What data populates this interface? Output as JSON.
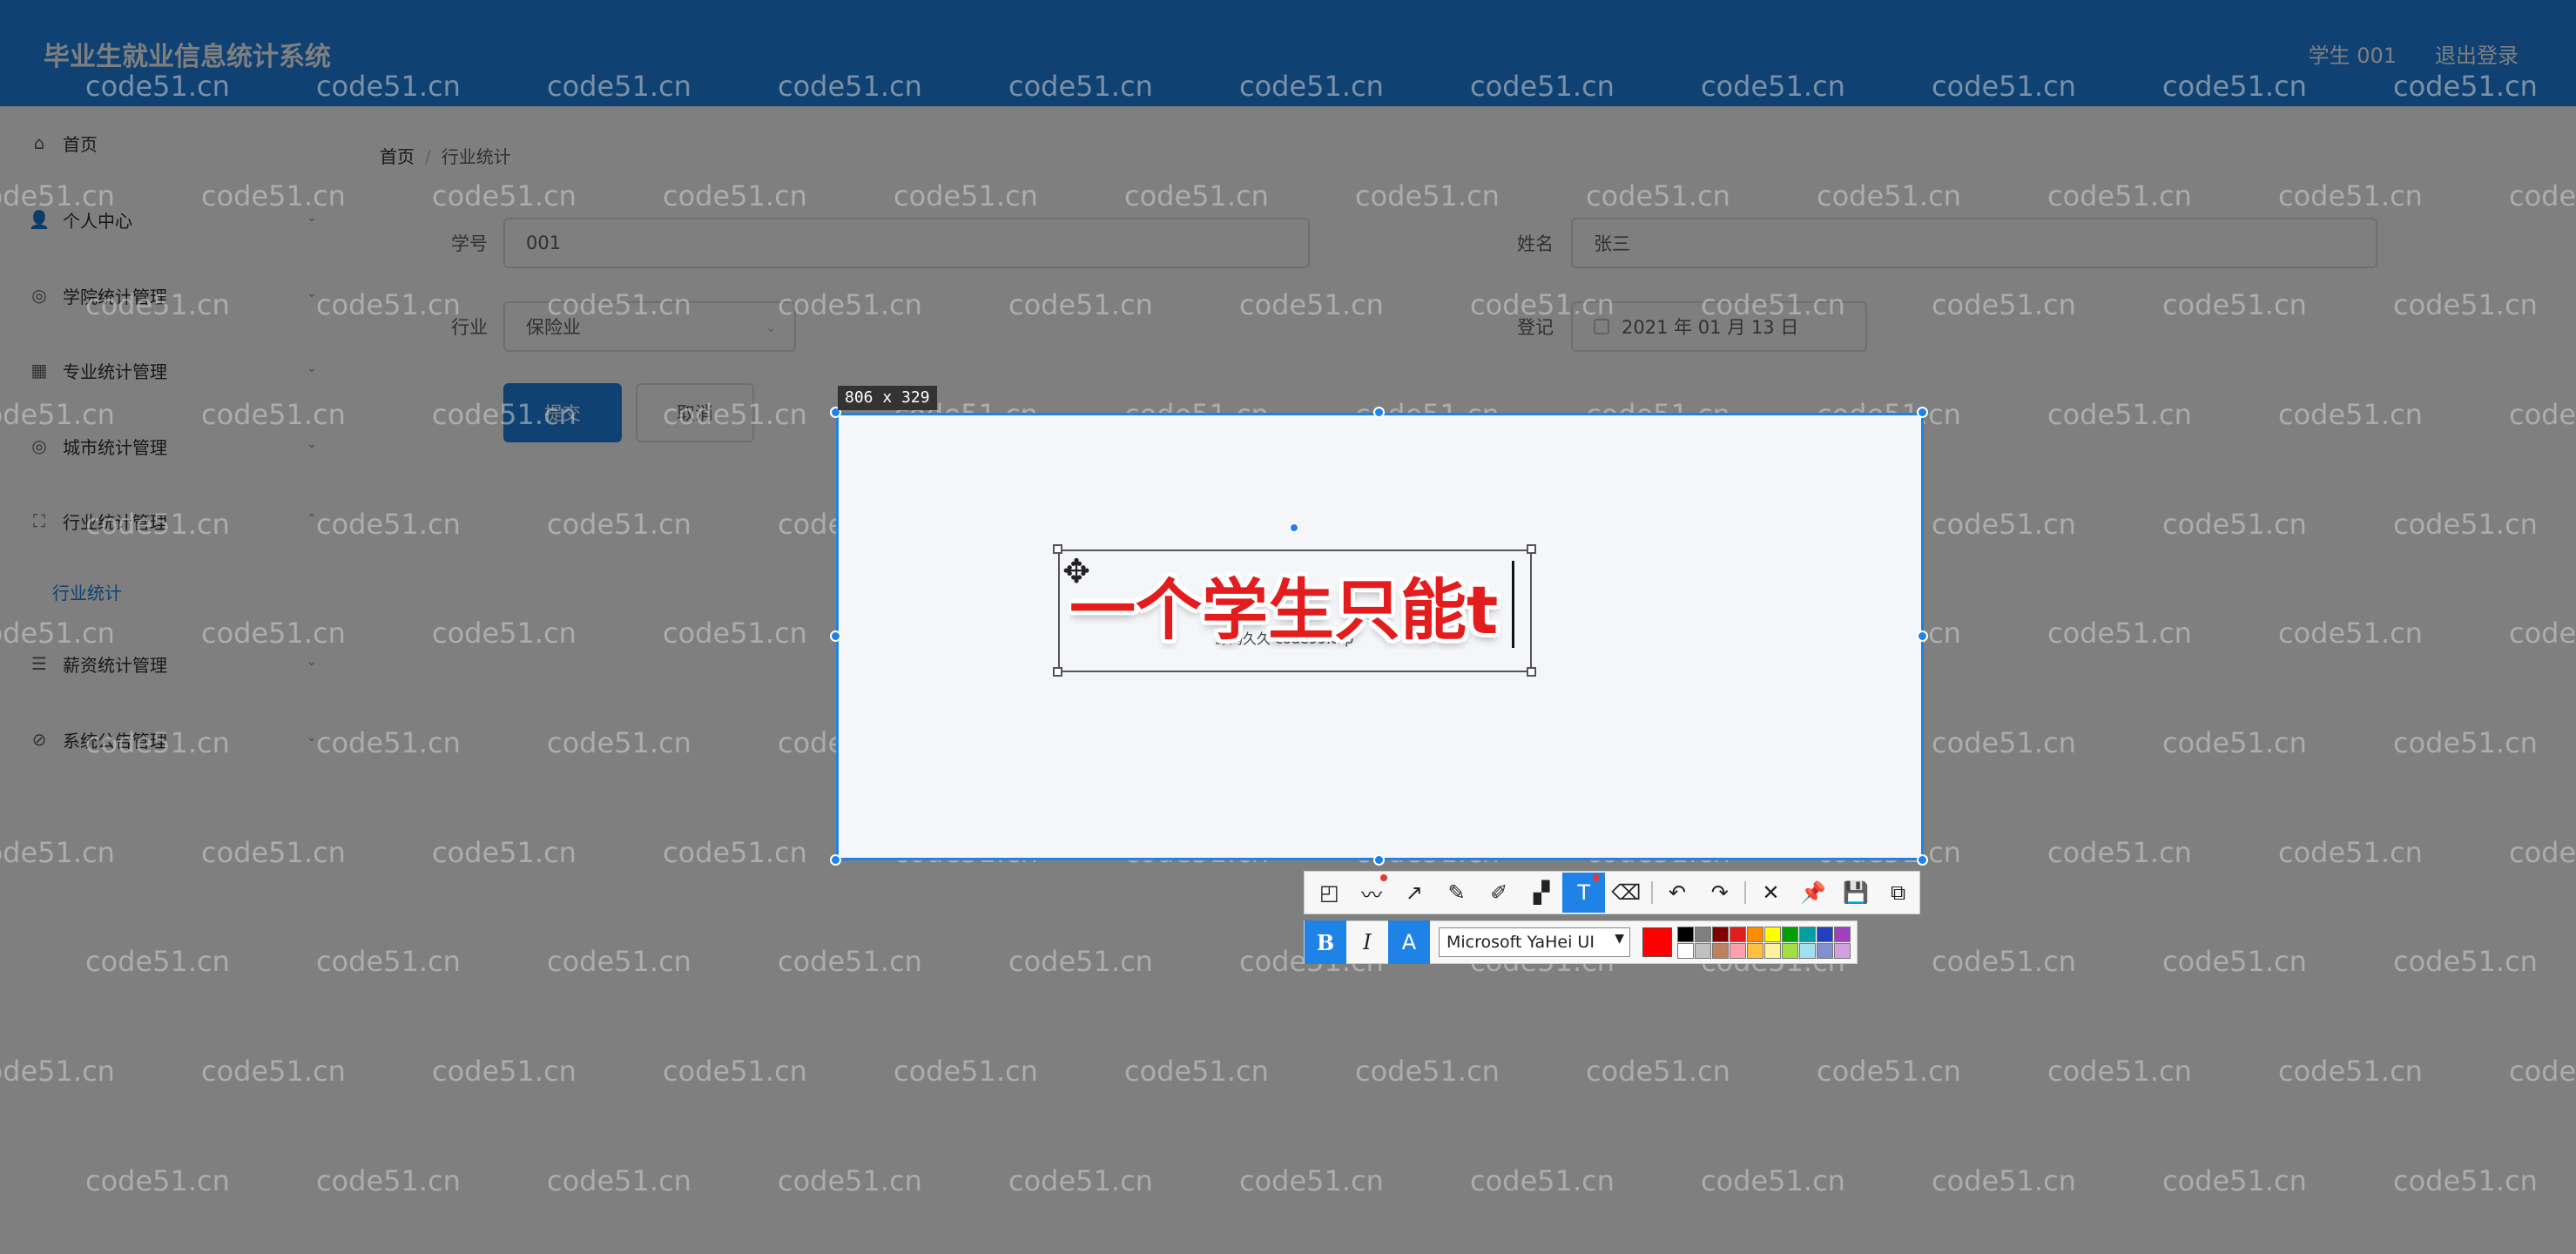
{
  "app": {
    "title": "毕业生就业信息统计系统",
    "user": "学生 001",
    "logout": "退出登录"
  },
  "sidebar": {
    "items": [
      {
        "label": "首页",
        "icon": "home-icon"
      },
      {
        "label": "个人中心",
        "icon": "user-icon"
      },
      {
        "label": "学院统计管理",
        "icon": "compass-icon"
      },
      {
        "label": "专业统计管理",
        "icon": "grid-icon"
      },
      {
        "label": "城市统计管理",
        "icon": "compass-icon"
      },
      {
        "label": "行业统计管理",
        "icon": "frame-icon"
      },
      {
        "label": "薪资统计管理",
        "icon": "list-icon"
      },
      {
        "label": "系统公告管理",
        "icon": "bell-off-icon"
      }
    ],
    "active_sub": "行业统计"
  },
  "breadcrumb": {
    "home": "首页",
    "sep": "/",
    "current": "行业统计"
  },
  "form": {
    "student_id_label": "学号",
    "student_id_value": "001",
    "name_label": "姓名",
    "name_value": "张三",
    "industry_label": "行业",
    "industry_value": "保险业",
    "register_label": "登记",
    "register_value": "2021 年 01 月 13 日",
    "submit": "提交",
    "cancel": "取消"
  },
  "capture": {
    "size_label": "806 x 329",
    "big_text": "一个学生只能t",
    "small_text": "源码久久 code99.top"
  },
  "watermark": "code51.cn",
  "toolbar": {
    "tools": [
      {
        "name": "rectangle-tool-icon",
        "glyph": "◰"
      },
      {
        "name": "curve-tool-icon",
        "glyph": "〰",
        "dot": true
      },
      {
        "name": "arrow-tool-icon",
        "glyph": "↗"
      },
      {
        "name": "pen-tool-icon",
        "glyph": "✎"
      },
      {
        "name": "marker-tool-icon",
        "glyph": "✐"
      },
      {
        "name": "mosaic-tool-icon",
        "glyph": "▞"
      },
      {
        "name": "text-tool-icon",
        "glyph": "T",
        "active": true,
        "dot": true
      },
      {
        "name": "eraser-tool-icon",
        "glyph": "⌫"
      },
      {
        "sep": true
      },
      {
        "name": "undo-icon",
        "glyph": "↶"
      },
      {
        "name": "redo-icon",
        "glyph": "↷"
      },
      {
        "sep": true
      },
      {
        "name": "close-icon",
        "glyph": "✕"
      },
      {
        "name": "pin-icon",
        "glyph": "📌"
      },
      {
        "name": "save-icon",
        "glyph": "💾"
      },
      {
        "name": "copy-icon",
        "glyph": "⧉"
      }
    ],
    "bold": "B",
    "italic": "I",
    "text_color_glyph": "A",
    "font": "Microsoft YaHei UI",
    "current_color": "#ff0000",
    "palette": [
      "#000000",
      "#808080",
      "#800000",
      "#e31d1d",
      "#ff8c00",
      "#ffff00",
      "#00a000",
      "#00a0a0",
      "#2040c0",
      "#a040c0",
      "#ffffff",
      "#c0c0c0",
      "#c08060",
      "#ff9fb0",
      "#ffc040",
      "#fff0a0",
      "#a0e040",
      "#a0e0f0",
      "#8090d0",
      "#d0a0e0"
    ]
  }
}
